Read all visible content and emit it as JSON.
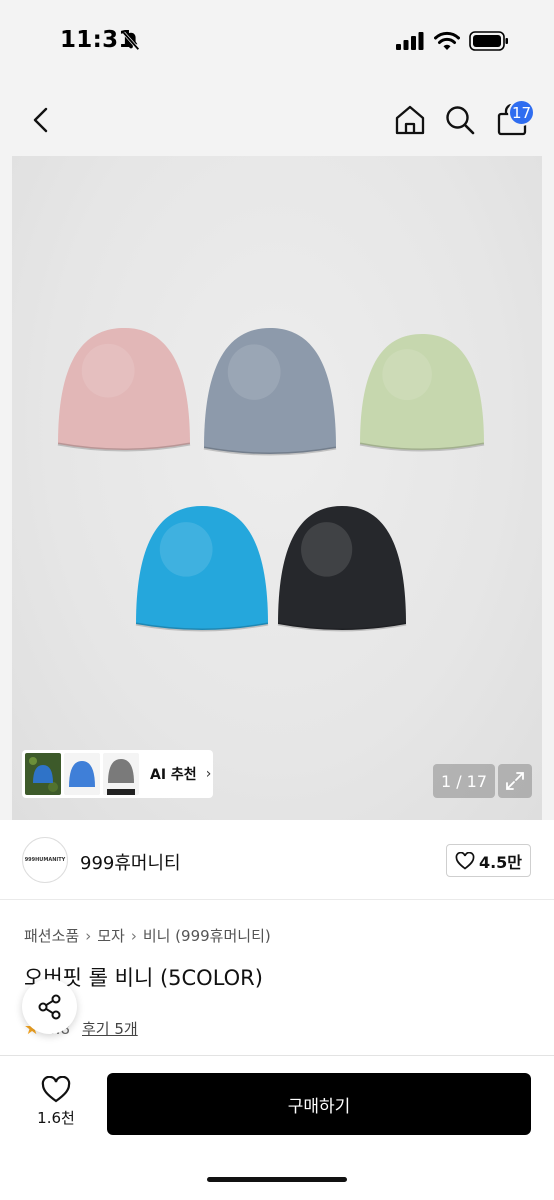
{
  "status": {
    "time": "11:31"
  },
  "header": {
    "cart_count": "17"
  },
  "gallery": {
    "ai_label": "AI 추천",
    "counter": "1 / 17",
    "beanie_colors": [
      "#e2b7b7",
      "#8d9aab",
      "#c6d7ae",
      "#25a7dc",
      "#26282c"
    ]
  },
  "seller": {
    "avatar_text": "999HUMANITY",
    "name": "999휴머니티",
    "likes": "4.5만"
  },
  "breadcrumb": [
    "패션소품",
    "모자",
    "비니 (999휴머니티)"
  ],
  "product": {
    "title": "오버핏 롤 비니 (5COLOR)",
    "rating": "4.8",
    "reviews": "후기 5개"
  },
  "bottom": {
    "wish_count": "1.6천",
    "buy_label": "구매하기"
  },
  "colors": {
    "accent": "#2f6df0",
    "buy_button": "#000000"
  }
}
